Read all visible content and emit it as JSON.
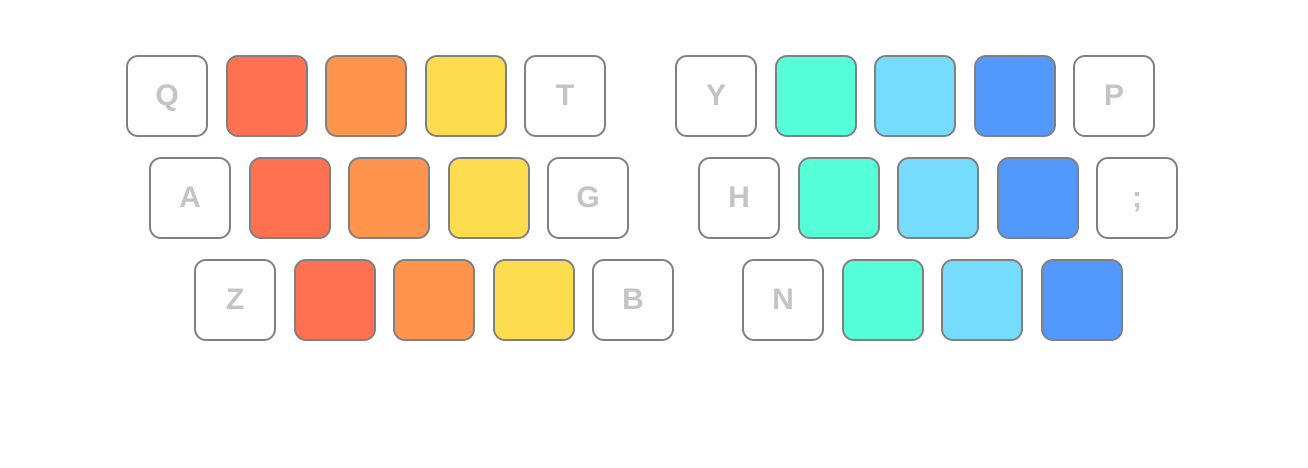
{
  "colors": {
    "red": "#ff7150",
    "orange": "#ff944c",
    "yellow": "#fddc4f",
    "aqua": "#55ffd8",
    "light_blue": "#75dcfd",
    "blue": "#5298fd",
    "blank": "#ffffff",
    "border": "#808080",
    "label": "#c4c4c4"
  },
  "keyboard": {
    "rows": [
      {
        "left": [
          {
            "label": "Q",
            "color": "blank"
          },
          {
            "label": "",
            "color": "red"
          },
          {
            "label": "",
            "color": "orange"
          },
          {
            "label": "",
            "color": "yellow"
          },
          {
            "label": "T",
            "color": "blank"
          }
        ],
        "right": [
          {
            "label": "Y",
            "color": "blank"
          },
          {
            "label": "",
            "color": "aqua"
          },
          {
            "label": "",
            "color": "light_blue"
          },
          {
            "label": "",
            "color": "blue"
          },
          {
            "label": "P",
            "color": "blank"
          }
        ]
      },
      {
        "left": [
          {
            "label": "A",
            "color": "blank"
          },
          {
            "label": "",
            "color": "red"
          },
          {
            "label": "",
            "color": "orange"
          },
          {
            "label": "",
            "color": "yellow"
          },
          {
            "label": "G",
            "color": "blank"
          }
        ],
        "right": [
          {
            "label": "H",
            "color": "blank"
          },
          {
            "label": "",
            "color": "aqua"
          },
          {
            "label": "",
            "color": "light_blue"
          },
          {
            "label": "",
            "color": "blue"
          },
          {
            "label": ";",
            "color": "blank"
          }
        ]
      },
      {
        "left": [
          {
            "label": "Z",
            "color": "blank"
          },
          {
            "label": "",
            "color": "red"
          },
          {
            "label": "",
            "color": "orange"
          },
          {
            "label": "",
            "color": "yellow"
          },
          {
            "label": "B",
            "color": "blank"
          }
        ],
        "right": [
          {
            "label": "N",
            "color": "blank"
          },
          {
            "label": "",
            "color": "aqua"
          },
          {
            "label": "",
            "color": "light_blue"
          },
          {
            "label": "",
            "color": "blue"
          }
        ]
      }
    ]
  }
}
